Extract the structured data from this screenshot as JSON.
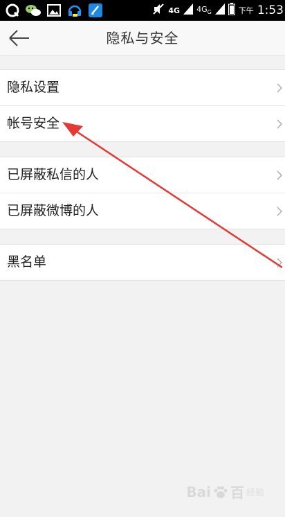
{
  "status_bar": {
    "icons": [
      "qq-icon",
      "wechat-icon",
      "gallery-icon",
      "headset-icon",
      "clean-icon"
    ],
    "network_primary": "4G",
    "network_secondary": "4G",
    "network_secondary_sub": "G",
    "time_prefix": "下午",
    "time": "1:53"
  },
  "header": {
    "title": "隐私与安全",
    "back_icon": "arrow-left-icon"
  },
  "groups": [
    {
      "items": [
        {
          "label": "隐私设置"
        },
        {
          "label": "帐号安全"
        }
      ]
    },
    {
      "items": [
        {
          "label": "已屏蔽私信的人"
        },
        {
          "label": "已屏蔽微博的人"
        }
      ]
    },
    {
      "items": [
        {
          "label": "黑名单"
        }
      ]
    }
  ],
  "annotation": {
    "color": "#e53935"
  },
  "watermark": {
    "brand_text": "Bai",
    "brand_text_2": "百",
    "sub_text": "经验"
  }
}
